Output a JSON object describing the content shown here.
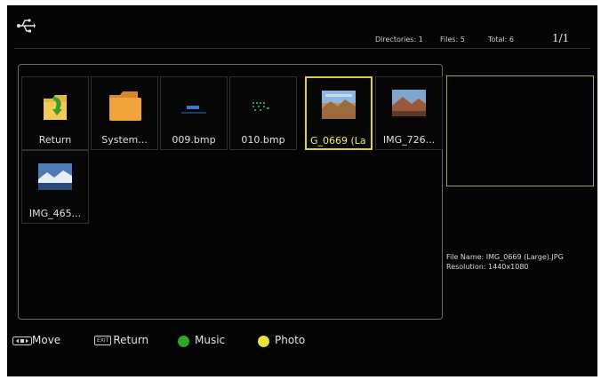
{
  "header": {
    "directories": "Directories: 1",
    "files": "Files: 5",
    "total": "Total: 6",
    "page": "1/1"
  },
  "grid": {
    "items": [
      {
        "label": "Return",
        "icon": "return-folder-icon"
      },
      {
        "label": "System...",
        "icon": "folder-icon"
      },
      {
        "label": "009.bmp",
        "icon": "bmp-thumbnail"
      },
      {
        "label": "010.bmp",
        "icon": "bmp-thumbnail"
      },
      {
        "label": "G_0669 (La",
        "icon": "photo-thumbnail",
        "selected": true
      },
      {
        "label": "IMG_726...",
        "icon": "photo-thumbnail"
      },
      {
        "label": "IMG_465...",
        "icon": "photo-thumbnail"
      }
    ]
  },
  "info": {
    "file_name": "File Name: IMG_0669 (Large).JPG",
    "resolution": "Resolution: 1440x1080"
  },
  "legend": {
    "move": "Move",
    "return": "Return",
    "music": "Music",
    "photo": "Photo",
    "exit_key": "EXIT"
  },
  "colors": {
    "selection": "#d9d23a",
    "music_dot": "#2fa82a",
    "photo_dot": "#e6e43a",
    "preview_border": "#8fb34d"
  }
}
